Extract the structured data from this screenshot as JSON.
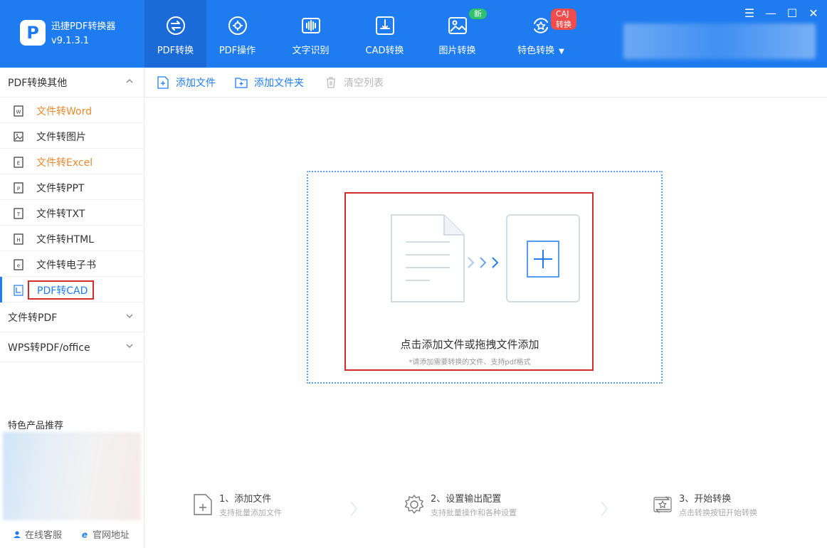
{
  "app": {
    "name": "迅捷PDF转换器",
    "version": "v9.1.3.1",
    "logo_letter": "P"
  },
  "nav": {
    "tabs": [
      {
        "label": "PDF转换",
        "icon": "convert-icon",
        "active": true
      },
      {
        "label": "PDF操作",
        "icon": "gear-circle-icon",
        "active": false
      },
      {
        "label": "文字识别",
        "icon": "waveform-icon",
        "active": false
      },
      {
        "label": "CAD转换",
        "icon": "cad-icon",
        "active": false
      },
      {
        "label": "图片转换",
        "icon": "image-icon",
        "active": false,
        "badge": "新"
      },
      {
        "label": "特色转换",
        "icon": "star-refresh-icon",
        "active": false,
        "badge": "CAJ转换",
        "dropdown": true
      }
    ]
  },
  "window_controls": {
    "menu": "☰",
    "minimize": "—",
    "maximize": "☐",
    "close": "✕"
  },
  "sidebar": {
    "groups": [
      {
        "label": "PDF转换其他",
        "expanded": true,
        "items": [
          {
            "label": "文件转Word",
            "icon": "word-file-icon",
            "letter": "W",
            "highlight": true
          },
          {
            "label": "文件转图片",
            "icon": "image-file-icon",
            "letter": "",
            "highlight": false
          },
          {
            "label": "文件转Excel",
            "icon": "excel-file-icon",
            "letter": "E",
            "highlight": true
          },
          {
            "label": "文件转PPT",
            "icon": "ppt-file-icon",
            "letter": "P",
            "highlight": false
          },
          {
            "label": "文件转TXT",
            "icon": "txt-file-icon",
            "letter": "T",
            "highlight": false
          },
          {
            "label": "文件转HTML",
            "icon": "html-file-icon",
            "letter": "H",
            "highlight": false
          },
          {
            "label": "文件转电子书",
            "icon": "ebook-file-icon",
            "letter": "e",
            "highlight": false
          },
          {
            "label": "PDF转CAD",
            "icon": "cad-file-icon",
            "letter": "",
            "active": true
          }
        ]
      },
      {
        "label": "文件转PDF",
        "expanded": false
      },
      {
        "label": "WPS转PDF/office",
        "expanded": false
      }
    ],
    "promo_title": "特色产品推荐",
    "footer": {
      "support": "在线客服",
      "website": "官网地址"
    }
  },
  "toolbar": {
    "add_file": "添加文件",
    "add_folder": "添加文件夹",
    "clear_list": "清空列表"
  },
  "dropzone": {
    "title": "点击添加文件或拖拽文件添加",
    "subtitle": "*请添加需要转换的文件、支持pdf格式"
  },
  "steps": [
    {
      "title": "1、添加文件",
      "desc": "支持批量添加文件",
      "icon": "add-file-icon"
    },
    {
      "title": "2、设置输出配置",
      "desc": "支持批量操作和各种设置",
      "icon": "settings-gear-icon"
    },
    {
      "title": "3、开始转换",
      "desc": "点击转换按钮开始转换",
      "icon": "start-convert-icon"
    }
  ],
  "colors": {
    "brand": "#1f7cf0",
    "highlight": "#e8892f",
    "annotation": "#d42b2b",
    "badge_new": "#2fc26b",
    "badge_caj": "#ef4d4d"
  }
}
